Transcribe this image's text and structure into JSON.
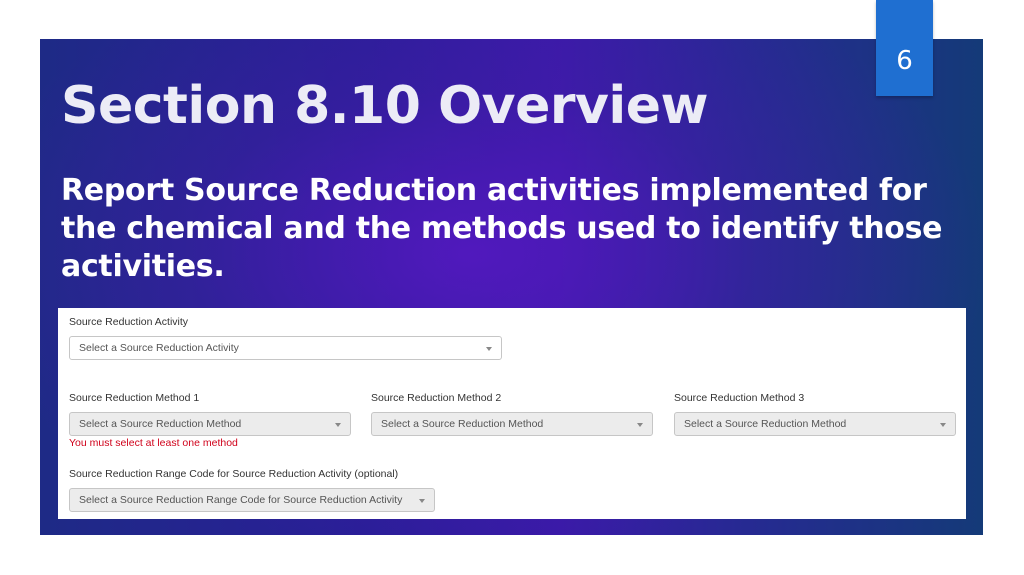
{
  "slide": {
    "page_number": "6",
    "title": "Section 8.10 Overview",
    "subtitle": "Report Source Reduction activities implemented for the chemical and the methods used to identify those activities."
  },
  "form": {
    "activity": {
      "label": "Source Reduction Activity",
      "placeholder": "Select a Source Reduction Activity"
    },
    "methods": [
      {
        "label": "Source Reduction Method 1",
        "placeholder": "Select a Source Reduction Method"
      },
      {
        "label": "Source Reduction Method 2",
        "placeholder": "Select a Source Reduction Method"
      },
      {
        "label": "Source Reduction Method 3",
        "placeholder": "Select a Source Reduction Method"
      }
    ],
    "method_error": "You must select at least one method",
    "range_code": {
      "label": "Source Reduction Range Code for Source Reduction Activity (optional)",
      "placeholder": "Select a Source Reduction Range Code for Source Reduction Activity"
    }
  },
  "icons": {
    "dropdown": "chevron-down-icon"
  },
  "colors": {
    "page_number_box": "#1f6fd1",
    "background_gradient_left": "#1e2a86",
    "background_gradient_center": "#3a1aa8",
    "background_gradient_right": "#143a78",
    "error": "#d0021b"
  }
}
